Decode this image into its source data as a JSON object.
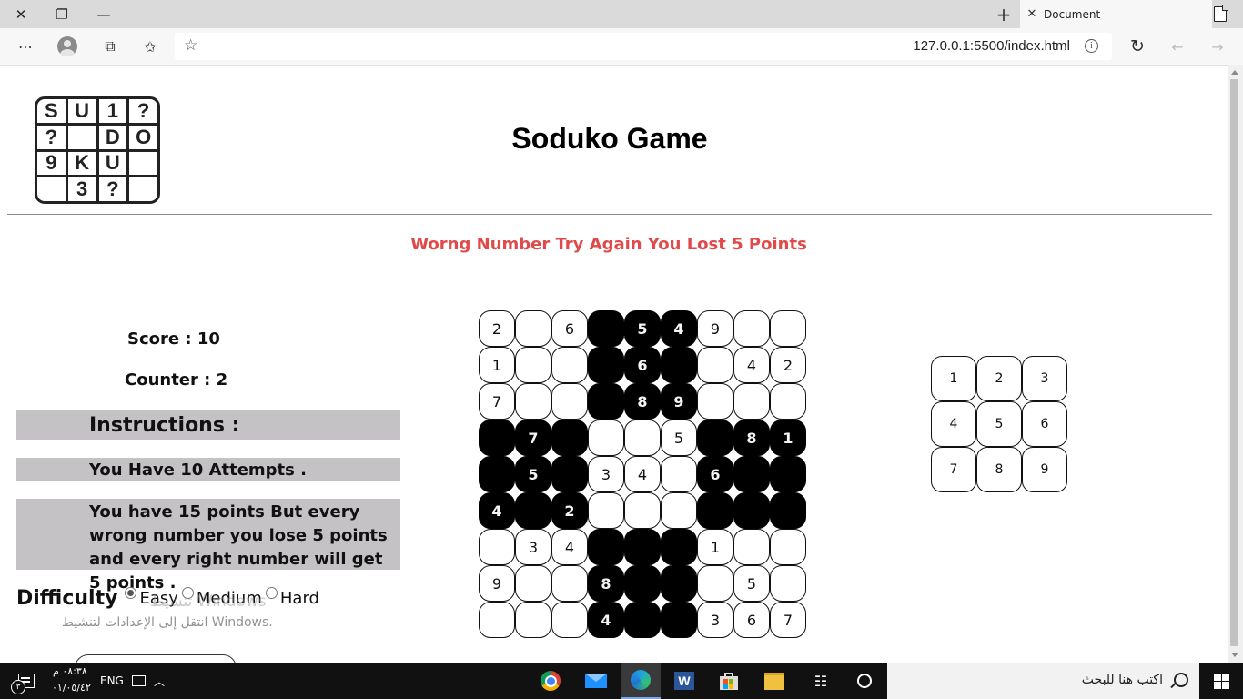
{
  "browser": {
    "tab_title": "Document",
    "url": "127.0.0.1:5500/index.html"
  },
  "page": {
    "logo_letters": [
      "S",
      "U",
      "1",
      "?",
      "?",
      "",
      "D",
      "O",
      "9",
      "K",
      "U",
      "",
      "",
      "3",
      "?",
      ""
    ],
    "title": "Soduko Game",
    "message": "Worng Number Try Again You Lost 5 Points",
    "score_text": "Score : 10",
    "counter_text": "Counter : 2",
    "instructions_heading": "Instructions :",
    "instruction_attempts": "You Have 10 Attempts .",
    "instruction_points": "You have 15 points But every wrong number you lose 5 points and every right number will get 5 points .",
    "difficulty_label": "Difficulty",
    "difficulty_options": [
      "Easy",
      "Medium",
      "Hard"
    ],
    "difficulty_selected": "Easy",
    "watermark_line1": "تنشيط Windows",
    "watermark_line2": "انتقل إلى الإعدادات لتنشيط Windows."
  },
  "board": {
    "cells": [
      [
        "2",
        "",
        "6",
        "",
        "5",
        "4",
        "9",
        "",
        ""
      ],
      [
        "1",
        "",
        "",
        "",
        "6",
        "",
        "",
        "4",
        "2"
      ],
      [
        "7",
        "",
        "",
        "",
        "8",
        "9",
        "",
        "",
        ""
      ],
      [
        "",
        "7",
        "",
        "",
        "",
        "5",
        "",
        "8",
        "1"
      ],
      [
        "",
        "5",
        "",
        "3",
        "4",
        "",
        "6",
        "",
        ""
      ],
      [
        "4",
        "",
        "2",
        "",
        "",
        "",
        "",
        "",
        ""
      ],
      [
        "",
        "3",
        "4",
        "",
        "",
        "",
        "1",
        "",
        ""
      ],
      [
        "9",
        "",
        "",
        "8",
        "",
        "",
        "",
        "5",
        ""
      ],
      [
        "",
        "",
        "",
        "4",
        "",
        "",
        "3",
        "6",
        "7"
      ]
    ],
    "dark_cells": [
      [
        0,
        0,
        0,
        1,
        1,
        1,
        0,
        0,
        0
      ],
      [
        0,
        0,
        0,
        1,
        1,
        1,
        0,
        0,
        0
      ],
      [
        0,
        0,
        0,
        1,
        1,
        1,
        0,
        0,
        0
      ],
      [
        1,
        1,
        1,
        0,
        0,
        0,
        1,
        1,
        1
      ],
      [
        1,
        1,
        1,
        0,
        0,
        0,
        1,
        1,
        1
      ],
      [
        1,
        1,
        1,
        0,
        0,
        0,
        1,
        1,
        1
      ],
      [
        0,
        0,
        0,
        1,
        1,
        1,
        0,
        0,
        0
      ],
      [
        0,
        0,
        0,
        1,
        1,
        1,
        0,
        0,
        0
      ],
      [
        0,
        0,
        0,
        1,
        1,
        1,
        0,
        0,
        0
      ]
    ]
  },
  "picker": [
    "1",
    "2",
    "3",
    "4",
    "5",
    "6",
    "7",
    "8",
    "9"
  ],
  "taskbar": {
    "search_placeholder": "اكتب هنا للبحث",
    "language": "ENG",
    "time": "٠٨:٣٨ م",
    "date": "٠١/٠٥/٤٢",
    "notification_count": "٣"
  },
  "colors": {
    "message": "#e04a4a",
    "panel_bg": "#c4c2c4",
    "dark_cell": "#000000"
  }
}
